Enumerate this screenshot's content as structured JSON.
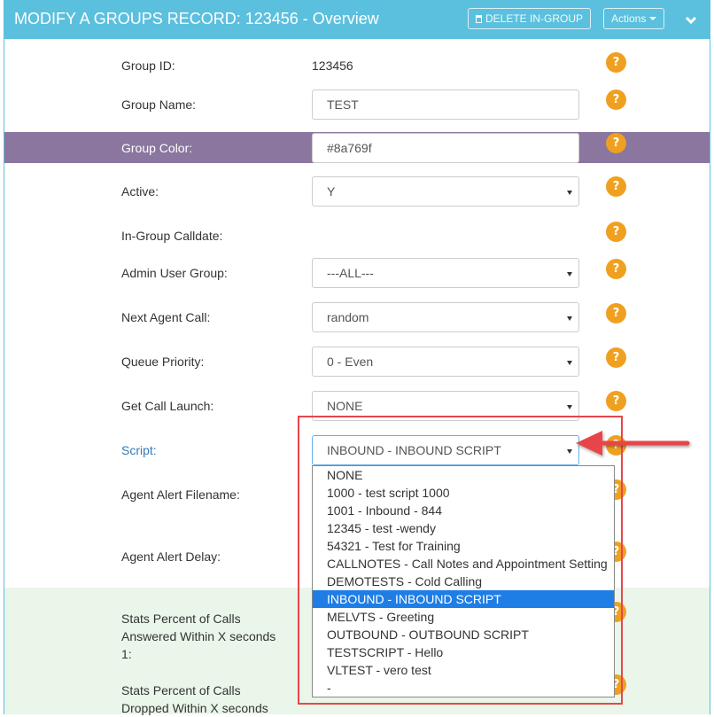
{
  "header": {
    "title": "MODIFY A GROUPS RECORD: 123456 - Overview",
    "delete_label": "DELETE IN-GROUP",
    "actions_label": "Actions"
  },
  "colors": {
    "header_bg": "#5bc0de",
    "help_icon": "#f0a020",
    "group_color_row": "#8a769f",
    "stats_section_bg": "#eaf6e9",
    "selected_option": "#1e7ee6",
    "highlight_annotation": "#e8454a"
  },
  "form": {
    "group_id": {
      "label": "Group ID:",
      "value": "123456"
    },
    "group_name": {
      "label": "Group Name:",
      "value": "TEST"
    },
    "group_color": {
      "label": "Group Color:",
      "value": "#8a769f"
    },
    "active": {
      "label": "Active:",
      "value": "Y"
    },
    "calldate": {
      "label": "In-Group Calldate:",
      "value": ""
    },
    "admin_user_group": {
      "label": "Admin User Group:",
      "value": "---ALL---"
    },
    "next_agent_call": {
      "label": "Next Agent Call:",
      "value": "random"
    },
    "queue_priority": {
      "label": "Queue Priority:",
      "value": "0 - Even"
    },
    "get_call_launch": {
      "label": "Get Call Launch:",
      "value": "NONE"
    },
    "script": {
      "label": "Script:",
      "value": "INBOUND - INBOUND SCRIPT"
    },
    "agent_alert_filename": {
      "label": "Agent Alert Filename:"
    },
    "agent_alert_delay": {
      "label": "Agent Alert Delay:"
    },
    "stats_answered": {
      "label_lines": [
        "Stats Percent of Calls",
        "Answered Within X seconds",
        "1:"
      ]
    },
    "stats_dropped": {
      "label_lines": [
        "Stats Percent of Calls",
        "Dropped Within X seconds"
      ]
    }
  },
  "help_glyph": "?",
  "script_dropdown": {
    "options": [
      "NONE",
      "1000 - test script 1000",
      "1001 - Inbound - 844",
      "12345 - test -wendy",
      "54321 - Test for Training",
      "CALLNOTES - Call Notes and Appointment Setting",
      "DEMOTESTS - Cold Calling",
      "INBOUND - INBOUND SCRIPT",
      "MELVTS - Greeting",
      "OUTBOUND - OUTBOUND SCRIPT",
      "TESTSCRIPT - Hello",
      "VLTEST - vero test",
      "-"
    ],
    "selected_index": 7
  }
}
